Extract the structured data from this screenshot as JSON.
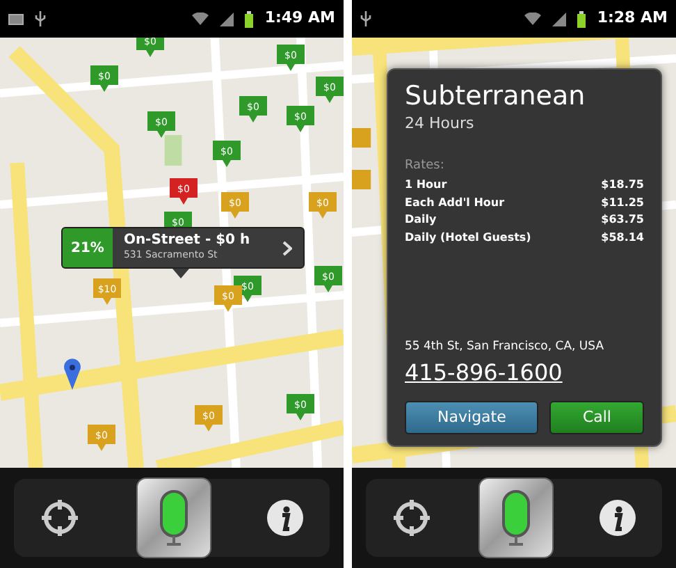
{
  "screens": [
    {
      "status_bar": {
        "time": "1:49 AM"
      },
      "pins": [
        {
          "label": "$0",
          "color": "#2f9a2a"
        },
        {
          "label": "$0",
          "color": "#2f9a2a"
        },
        {
          "label": "$0",
          "color": "#2f9a2a"
        },
        {
          "label": "$0",
          "color": "#2f9a2a"
        },
        {
          "label": "$0",
          "color": "#2f9a2a"
        },
        {
          "label": "$0",
          "color": "#2f9a2a"
        },
        {
          "label": "$0",
          "color": "#2f9a2a"
        },
        {
          "label": "$0",
          "color": "#2f9a2a"
        },
        {
          "label": "$0",
          "color": "#d42222"
        },
        {
          "label": "$0",
          "color": "#d9a21e"
        },
        {
          "label": "$0",
          "color": "#d9a21e"
        },
        {
          "label": "$0",
          "color": "#2f9a2a"
        },
        {
          "label": "$10",
          "color": "#d9a21e"
        },
        {
          "label": "$0",
          "color": "#2f9a2a"
        },
        {
          "label": "$0",
          "color": "#d9a21e"
        },
        {
          "label": "$0",
          "color": "#2f9a2a"
        },
        {
          "label": "$0",
          "color": "#2f9a2a"
        },
        {
          "label": "$0",
          "color": "#d9a21e"
        },
        {
          "label": "$0",
          "color": "#d9a21e"
        }
      ],
      "callout": {
        "percent": "21%",
        "title": "On-Street - $0 h",
        "address": "531 Sacramento St"
      }
    },
    {
      "status_bar": {
        "time": "1:28 AM"
      },
      "place_card": {
        "title": "Subterranean",
        "hours": "24 Hours",
        "rates_label": "Rates:",
        "rates": [
          {
            "label": "1 Hour",
            "price": "$18.75"
          },
          {
            "label": "Each Add'l Hour",
            "price": "$11.25"
          },
          {
            "label": "Daily",
            "price": "$63.75"
          },
          {
            "label": "Daily (Hotel Guests)",
            "price": "$58.14"
          }
        ],
        "address": "55 4th St, San Francisco, CA, USA",
        "phone": "415-896-1600",
        "buttons": [
          {
            "label": "Navigate",
            "kind": "navigate"
          },
          {
            "label": "Call",
            "kind": "call"
          }
        ]
      }
    }
  ]
}
